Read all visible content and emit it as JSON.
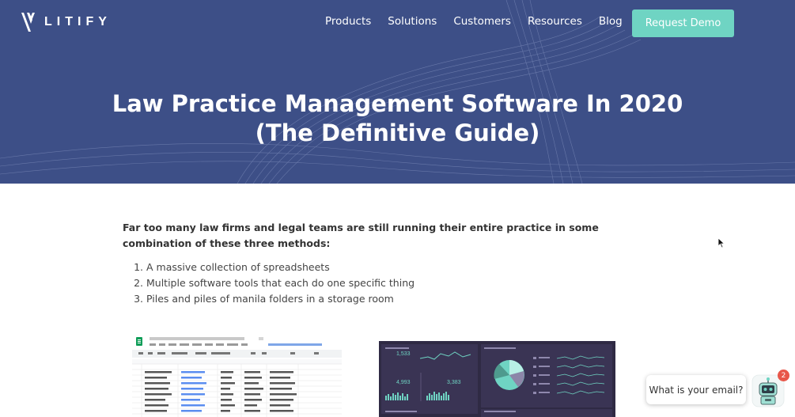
{
  "brand": {
    "name": "LITIFY"
  },
  "nav": {
    "items": [
      {
        "label": "Products"
      },
      {
        "label": "Solutions"
      },
      {
        "label": "Customers"
      },
      {
        "label": "Resources"
      },
      {
        "label": "Blog"
      }
    ],
    "cta_label": "Request Demo"
  },
  "hero": {
    "title_line1": "Law Practice Management Software In 2020",
    "title_line2": "(The Definitive Guide)"
  },
  "article": {
    "intro": "Far too many law firms and legal teams are still running their entire practice in some combination of these three methods:",
    "methods": [
      "A massive collection of spreadsheets",
      "Multiple software tools that each do one specific thing",
      "Piles and piles of manila folders in a storage room"
    ]
  },
  "dashboard": {
    "stats": [
      "1,533",
      "4,993",
      "3,383"
    ]
  },
  "chat": {
    "placeholder": "What is your email?",
    "badge_count": "2"
  },
  "colors": {
    "hero_bg": "#3d4f87",
    "accent": "#6fd4c3",
    "badge": "#e8574a"
  }
}
